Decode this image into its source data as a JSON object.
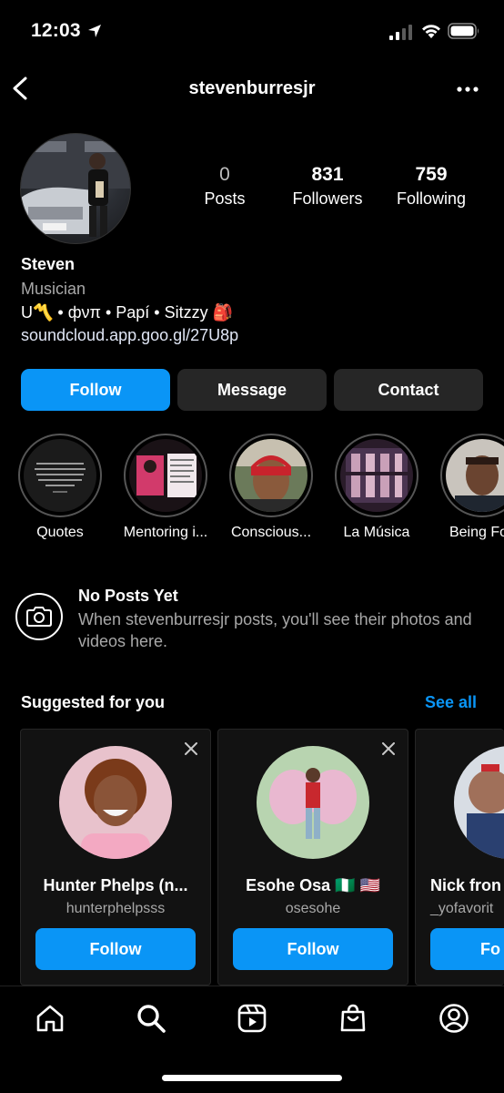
{
  "status_bar": {
    "time": "12:03"
  },
  "header": {
    "username": "stevenburresjr"
  },
  "stats": [
    {
      "value": "0",
      "label": "Posts"
    },
    {
      "value": "831",
      "label": "Followers"
    },
    {
      "value": "759",
      "label": "Following"
    }
  ],
  "profile": {
    "name": "Steven",
    "category": "Musician",
    "bio": "U〽️ • фνπ • Papí • Sitzzy 🎒",
    "link": "soundcloud.app.goo.gl/27U8p"
  },
  "actions": {
    "follow": "Follow",
    "message": "Message",
    "contact": "Contact"
  },
  "highlights": [
    {
      "label": "Quotes"
    },
    {
      "label": "Mentoring i..."
    },
    {
      "label": "Conscious..."
    },
    {
      "label": "La Música"
    },
    {
      "label": "Being Foc"
    }
  ],
  "no_posts": {
    "title": "No Posts Yet",
    "text": "When stevenburresjr posts, you'll see their photos and videos here."
  },
  "suggested": {
    "title": "Suggested for you",
    "see_all": "See all",
    "cards": [
      {
        "name": "Hunter Phelps (n...",
        "handle": "hunterphelpsss",
        "button": "Follow"
      },
      {
        "name": "Esohe Osa 🇳🇬 🇺🇸",
        "handle": "osesohe",
        "button": "Follow"
      },
      {
        "name": "Nick fron",
        "handle": "_yofavorit",
        "button": "Fo"
      }
    ]
  },
  "colors": {
    "accent": "#0a95f6",
    "secondary_button": "#262626",
    "muted_text": "#a8a8a8"
  },
  "tab_bar": [
    "home-icon",
    "search-icon",
    "reels-icon",
    "shop-icon",
    "profile-icon"
  ]
}
